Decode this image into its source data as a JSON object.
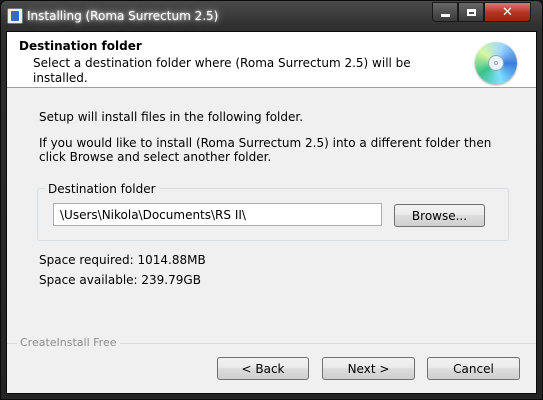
{
  "window": {
    "title": "Installing (Roma Surrectum 2.5)",
    "controls": {
      "minimize": "minimize",
      "maximize": "maximize",
      "close": "✕"
    }
  },
  "header": {
    "title": "Destination folder",
    "subtitle": "Select a destination folder where (Roma Surrectum 2.5) will be installed.",
    "icon": "cd-install-icon"
  },
  "body": {
    "intro_line1": "Setup will install files in the following folder.",
    "intro_line2": "If you would like to install (Roma Surrectum 2.5) into a different folder then click Browse and select another folder.",
    "group_label": "Destination folder",
    "path_value": "\\Users\\Nikola\\Documents\\RS II\\",
    "browse_label": "Browse...",
    "space_required": "Space required: 1014.88MB",
    "space_available": "Space available: 239.79GB"
  },
  "footer": {
    "brand": "CreateInstall Free",
    "back_label": "< Back",
    "next_label": "Next >",
    "cancel_label": "Cancel"
  },
  "colors": {
    "titlebar": "#2f2f2f",
    "close_button": "#c0392b",
    "client_bg": "#f0f0f0",
    "header_bg": "#ffffff"
  }
}
